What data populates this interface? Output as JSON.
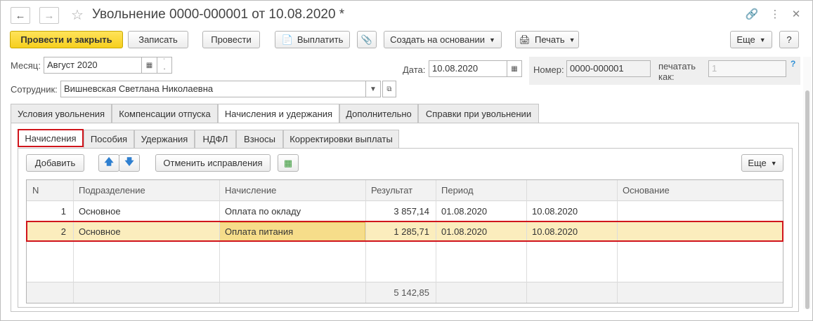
{
  "window": {
    "title": "Увольнение 0000-000001 от 10.08.2020 *"
  },
  "toolbar": {
    "post_close": "Провести и закрыть",
    "save": "Записать",
    "post": "Провести",
    "pay": "Выплатить",
    "create_based": "Создать на основании",
    "print": "Печать",
    "more": "Еще",
    "help": "?"
  },
  "form": {
    "month_label": "Месяц:",
    "month_value": "Август 2020",
    "date_label": "Дата:",
    "date_value": "10.08.2020",
    "number_label": "Номер:",
    "number_value": "0000-000001",
    "print_as_label_1": "печатать",
    "print_as_label_2": "как:",
    "print_as_value": "1",
    "employee_label": "Сотрудник:",
    "employee_value": "Вишневская Светлана Николаевна"
  },
  "tabs": [
    "Условия увольнения",
    "Компенсации отпуска",
    "Начисления и удержания",
    "Дополнительно",
    "Справки при увольнении"
  ],
  "subtabs": [
    "Начисления",
    "Пособия",
    "Удержания",
    "НДФЛ",
    "Взносы",
    "Корректировки выплаты"
  ],
  "grid_toolbar": {
    "add": "Добавить",
    "cancel_corrections": "Отменить исправления",
    "more": "Еще"
  },
  "table": {
    "columns": [
      "N",
      "Подразделение",
      "Начисление",
      "Результат",
      "Период",
      "",
      "Основание"
    ],
    "rows": [
      {
        "n": "1",
        "division": "Основное",
        "accrual": "Оплата по окладу",
        "result": "3 857,14",
        "period_from": "01.08.2020",
        "period_to": "10.08.2020",
        "basis": ""
      },
      {
        "n": "2",
        "division": "Основное",
        "accrual": "Оплата питания",
        "result": "1 285,71",
        "period_from": "01.08.2020",
        "period_to": "10.08.2020",
        "basis": ""
      }
    ],
    "total_result": "5 142,85"
  }
}
